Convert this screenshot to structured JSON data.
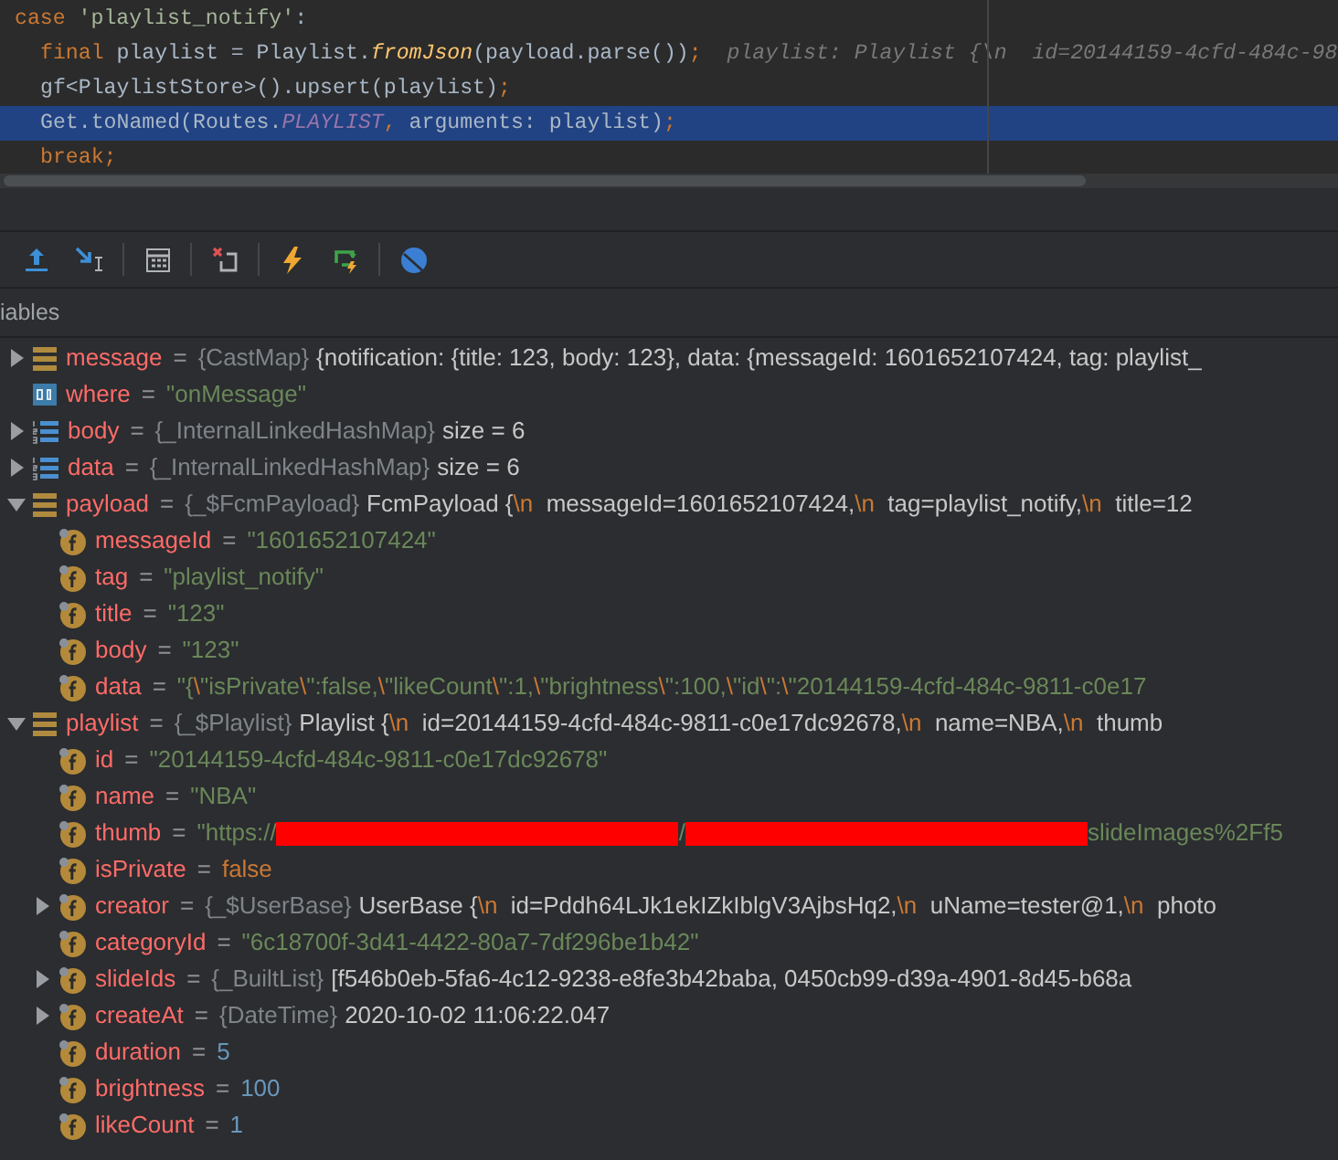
{
  "editor": {
    "lines": [
      {
        "highlighted": false,
        "tokens": [
          {
            "kind": "keyword",
            "text": "case"
          },
          {
            "kind": "string",
            "text": " 'playlist_notify'"
          },
          {
            "kind": "plain",
            "text": ":"
          }
        ],
        "children": [
          {
            "highlighted": false,
            "tokens": [
              {
                "kind": "keyword",
                "text": "final"
              },
              {
                "kind": "plain",
                "text": " playlist = Playlist."
              },
              {
                "kind": "method",
                "text": "fromJson"
              },
              {
                "kind": "plain",
                "text": "(payload.parse())"
              },
              {
                "kind": "keyword",
                "text": ";"
              },
              {
                "kind": "hint",
                "text": "  playlist: Playlist {\\n  id=20144159-4cfd-484c-98"
              }
            ]
          },
          {
            "highlighted": false,
            "tokens": [
              {
                "kind": "plain",
                "text": "gf<PlaylistStore>().upsert(playlist)"
              },
              {
                "kind": "keyword",
                "text": ";"
              }
            ]
          },
          {
            "highlighted": true,
            "tokens": [
              {
                "kind": "plain",
                "text": "Get.toNamed(Routes."
              },
              {
                "kind": "constant",
                "text": "PLAYLIST"
              },
              {
                "kind": "keyword",
                "text": ","
              },
              {
                "kind": "plain",
                "text": " arguments: playlist)"
              },
              {
                "kind": "keyword",
                "text": ";"
              }
            ]
          },
          {
            "highlighted": false,
            "tokens": [
              {
                "kind": "keyword",
                "text": "break;"
              }
            ]
          }
        ]
      }
    ]
  },
  "variables": {
    "header": "iables",
    "items": [
      {
        "kind": "map",
        "name": "message",
        "expanded": false,
        "value": [
          {
            "kind": "operator",
            "text": "="
          },
          {
            "kind": "type",
            "text": "{CastMap}"
          },
          {
            "kind": "plain",
            "text": "{notification: {title: 123, body: 123}, data: {messageId: 1601652107424, tag: playlist_"
          }
        ]
      },
      {
        "kind": "primitive",
        "name": "where",
        "value": [
          {
            "kind": "operator",
            "text": "="
          },
          {
            "kind": "string",
            "text": "\"onMessage\""
          }
        ]
      },
      {
        "kind": "list",
        "name": "body",
        "expanded": false,
        "value": [
          {
            "kind": "operator",
            "text": "="
          },
          {
            "kind": "type",
            "text": "{_InternalLinkedHashMap}"
          },
          {
            "kind": "plain",
            "text": "size = 6"
          }
        ]
      },
      {
        "kind": "list",
        "name": "data",
        "expanded": false,
        "value": [
          {
            "kind": "operator",
            "text": "="
          },
          {
            "kind": "type",
            "text": "{_InternalLinkedHashMap}"
          },
          {
            "kind": "plain",
            "text": "size = 6"
          }
        ]
      },
      {
        "kind": "map",
        "name": "payload",
        "expanded": true,
        "value": [
          {
            "kind": "operator",
            "text": "="
          },
          {
            "kind": "type",
            "text": "{_$FcmPayload}"
          },
          {
            "kind": "plain",
            "text": "FcmPayload {"
          },
          {
            "kind": "escape",
            "text": "\\n"
          },
          {
            "kind": "plain",
            "text": "  messageId=1601652107424,"
          },
          {
            "kind": "escape",
            "text": "\\n"
          },
          {
            "kind": "plain",
            "text": "  tag=playlist_notify,"
          },
          {
            "kind": "escape",
            "text": "\\n"
          },
          {
            "kind": "plain",
            "text": "  title=12"
          }
        ],
        "children": [
          {
            "kind": "field",
            "name": "messageId",
            "value": [
              {
                "kind": "operator",
                "text": "="
              },
              {
                "kind": "string",
                "text": "\"1601652107424\""
              }
            ]
          },
          {
            "kind": "field",
            "name": "tag",
            "value": [
              {
                "kind": "operator",
                "text": "="
              },
              {
                "kind": "string",
                "text": "\"playlist_notify\""
              }
            ]
          },
          {
            "kind": "field",
            "name": "title",
            "value": [
              {
                "kind": "operator",
                "text": "="
              },
              {
                "kind": "string",
                "text": "\"123\""
              }
            ]
          },
          {
            "kind": "field",
            "name": "body",
            "value": [
              {
                "kind": "operator",
                "text": "="
              },
              {
                "kind": "string",
                "text": "\"123\""
              }
            ]
          },
          {
            "kind": "field",
            "name": "data",
            "value": [
              {
                "kind": "operator",
                "text": "="
              },
              {
                "kind": "string",
                "text": "\"{"
              },
              {
                "kind": "escape",
                "text": "\\"
              },
              {
                "kind": "string",
                "text": "\"isPrivate"
              },
              {
                "kind": "escape",
                "text": "\\"
              },
              {
                "kind": "string",
                "text": "\":false,"
              },
              {
                "kind": "escape",
                "text": "\\"
              },
              {
                "kind": "string",
                "text": "\"likeCount"
              },
              {
                "kind": "escape",
                "text": "\\"
              },
              {
                "kind": "string",
                "text": "\":1,"
              },
              {
                "kind": "escape",
                "text": "\\"
              },
              {
                "kind": "string",
                "text": "\"brightness"
              },
              {
                "kind": "escape",
                "text": "\\"
              },
              {
                "kind": "string",
                "text": "\":100,"
              },
              {
                "kind": "escape",
                "text": "\\"
              },
              {
                "kind": "string",
                "text": "\"id"
              },
              {
                "kind": "escape",
                "text": "\\"
              },
              {
                "kind": "string",
                "text": "\":"
              },
              {
                "kind": "escape",
                "text": "\\"
              },
              {
                "kind": "string",
                "text": "\"20144159-4cfd-484c-9811-c0e17"
              }
            ]
          }
        ]
      },
      {
        "kind": "map",
        "name": "playlist",
        "expanded": true,
        "value": [
          {
            "kind": "operator",
            "text": "="
          },
          {
            "kind": "type",
            "text": "{_$Playlist}"
          },
          {
            "kind": "plain",
            "text": "Playlist {"
          },
          {
            "kind": "escape",
            "text": "\\n"
          },
          {
            "kind": "plain",
            "text": "  id=20144159-4cfd-484c-9811-c0e17dc92678,"
          },
          {
            "kind": "escape",
            "text": "\\n"
          },
          {
            "kind": "plain",
            "text": "  name=NBA,"
          },
          {
            "kind": "escape",
            "text": "\\n"
          },
          {
            "kind": "plain",
            "text": "  thumb"
          }
        ],
        "children": [
          {
            "kind": "field",
            "name": "id",
            "value": [
              {
                "kind": "operator",
                "text": "="
              },
              {
                "kind": "string",
                "text": "\"20144159-4cfd-484c-9811-c0e17dc92678\""
              }
            ]
          },
          {
            "kind": "field",
            "name": "name",
            "value": [
              {
                "kind": "operator",
                "text": "="
              },
              {
                "kind": "string",
                "text": "\"NBA\""
              }
            ]
          },
          {
            "kind": "field",
            "name": "thumb",
            "value": [
              {
                "kind": "operator",
                "text": "="
              },
              {
                "kind": "string",
                "text": "\"https://"
              },
              {
                "kind": "redacted"
              },
              {
                "kind": "string",
                "text": "/"
              },
              {
                "kind": "redacted"
              },
              {
                "kind": "string",
                "text": "slideImages%2Ff5"
              }
            ]
          },
          {
            "kind": "field",
            "name": "isPrivate",
            "value": [
              {
                "kind": "operator",
                "text": "="
              },
              {
                "kind": "keyword",
                "text": "false"
              }
            ]
          },
          {
            "kind": "field",
            "name": "creator",
            "expanded": false,
            "value": [
              {
                "kind": "operator",
                "text": "="
              },
              {
                "kind": "type",
                "text": "{_$UserBase}"
              },
              {
                "kind": "plain",
                "text": "UserBase {"
              },
              {
                "kind": "escape",
                "text": "\\n"
              },
              {
                "kind": "plain",
                "text": "  id=Pddh64LJk1ekIZkIblgV3AjbsHq2,"
              },
              {
                "kind": "escape",
                "text": "\\n"
              },
              {
                "kind": "plain",
                "text": "  uName=tester@1,"
              },
              {
                "kind": "escape",
                "text": "\\n"
              },
              {
                "kind": "plain",
                "text": "  photo"
              }
            ]
          },
          {
            "kind": "field",
            "name": "categoryId",
            "value": [
              {
                "kind": "operator",
                "text": "="
              },
              {
                "kind": "string",
                "text": "\"6c18700f-3d41-4422-80a7-7df296be1b42\""
              }
            ]
          },
          {
            "kind": "field",
            "name": "slideIds",
            "expanded": false,
            "value": [
              {
                "kind": "operator",
                "text": "="
              },
              {
                "kind": "type",
                "text": "{_BuiltList}"
              },
              {
                "kind": "plain",
                "text": "[f546b0eb-5fa6-4c12-9238-e8fe3b42baba, 0450cb99-d39a-4901-8d45-b68a"
              }
            ]
          },
          {
            "kind": "field",
            "name": "createAt",
            "expanded": false,
            "value": [
              {
                "kind": "operator",
                "text": "="
              },
              {
                "kind": "type",
                "text": "{DateTime}"
              },
              {
                "kind": "plain",
                "text": "2020-10-02 11:06:22.047"
              }
            ]
          },
          {
            "kind": "field",
            "name": "duration",
            "value": [
              {
                "kind": "operator",
                "text": "="
              },
              {
                "kind": "number",
                "text": "5"
              }
            ]
          },
          {
            "kind": "field",
            "name": "brightness",
            "value": [
              {
                "kind": "operator",
                "text": "="
              },
              {
                "kind": "number",
                "text": "100"
              }
            ]
          },
          {
            "kind": "field",
            "name": "likeCount",
            "value": [
              {
                "kind": "operator",
                "text": "="
              },
              {
                "kind": "number",
                "text": "1"
              }
            ]
          }
        ]
      }
    ]
  }
}
